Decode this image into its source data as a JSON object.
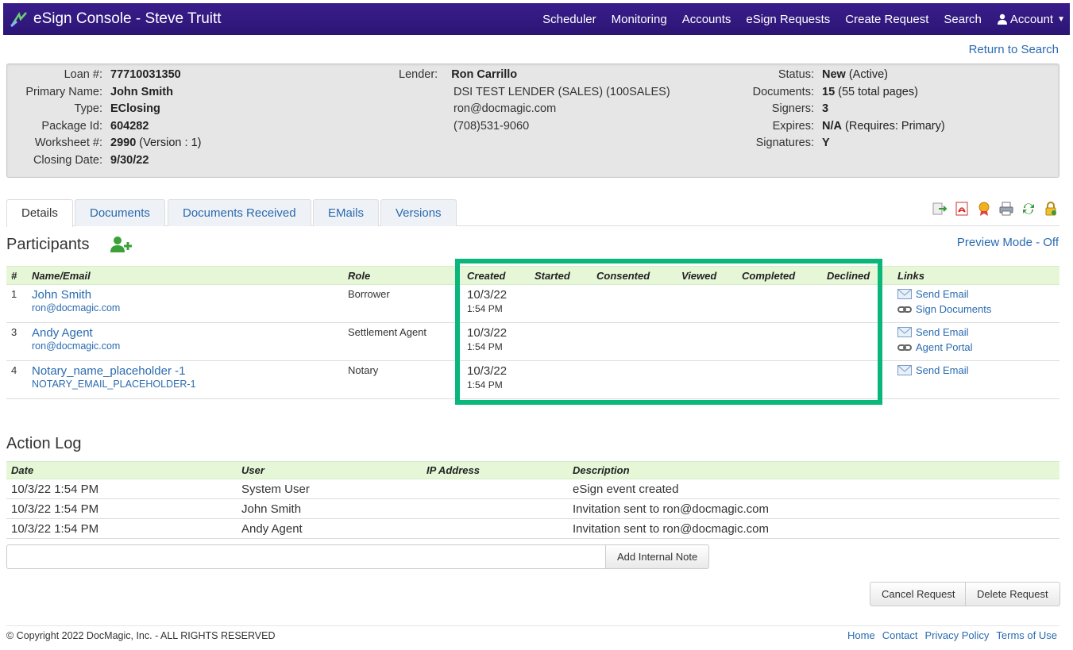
{
  "navbar": {
    "brand": "eSign Console - Steve Truitt",
    "links": [
      "Scheduler",
      "Monitoring",
      "Accounts",
      "eSign Requests",
      "Create Request",
      "Search"
    ],
    "account": "Account"
  },
  "return_link": "Return to Search",
  "info": {
    "col1": [
      {
        "label": "Loan #:",
        "value": "77710031350"
      },
      {
        "label": "Primary Name:",
        "value": "John Smith"
      },
      {
        "label": "Type:",
        "value": "EClosing"
      },
      {
        "label": "Package Id:",
        "value": "604282"
      },
      {
        "label": "Worksheet #:",
        "value": "2990",
        "extra": " (Version : 1)"
      },
      {
        "label": "Closing Date:",
        "value": "9/30/22"
      }
    ],
    "lender": {
      "label": "Lender:",
      "name": "Ron Carrillo",
      "company": "DSI TEST LENDER (SALES) (100SALES)",
      "email": "ron@docmagic.com",
      "phone": "(708)531-9060"
    },
    "col3": [
      {
        "label": "Status:",
        "value": "New",
        "extra": " (Active)"
      },
      {
        "label": "Documents:",
        "value": "15",
        "extra": " (55 total pages)"
      },
      {
        "label": "Signers:",
        "value": "3",
        "extra": ""
      },
      {
        "label": "Expires:",
        "value": "N/A",
        "extra": " (Requires: Primary)"
      },
      {
        "label": "Signatures:",
        "value": "Y",
        "extra": ""
      }
    ]
  },
  "tabs": [
    "Details",
    "Documents",
    "Documents Received",
    "EMails",
    "Versions"
  ],
  "toolbar_icons": [
    "export-icon",
    "pdf-icon",
    "certificate-icon",
    "print-icon",
    "refresh-icon",
    "lock-icon"
  ],
  "participants": {
    "title": "Participants",
    "preview_mode": "Preview Mode - Off",
    "columns": [
      "#",
      "Name/Email",
      "Role",
      "Created",
      "Started",
      "Consented",
      "Viewed",
      "Completed",
      "Declined",
      "Links"
    ],
    "rows": [
      {
        "num": "1",
        "name": "John Smith",
        "email": "ron@docmagic.com",
        "role": "Borrower",
        "created_date": "10/3/22",
        "created_time": "1:54 PM",
        "links": [
          {
            "icon": "email-icon",
            "label": "Send Email"
          },
          {
            "icon": "chain-link-icon",
            "label": "Sign Documents"
          }
        ]
      },
      {
        "num": "3",
        "name": "Andy Agent",
        "email": "ron@docmagic.com",
        "role": "Settlement Agent",
        "created_date": "10/3/22",
        "created_time": "1:54 PM",
        "links": [
          {
            "icon": "email-icon",
            "label": "Send Email"
          },
          {
            "icon": "chain-link-icon",
            "label": "Agent Portal"
          }
        ]
      },
      {
        "num": "4",
        "name": "Notary_name_placeholder -1",
        "email": "NOTARY_EMAIL_PLACEHOLDER-1",
        "role": "Notary",
        "created_date": "10/3/22",
        "created_time": "1:54 PM",
        "links": [
          {
            "icon": "email-icon",
            "label": "Send Email"
          }
        ]
      }
    ]
  },
  "action_log": {
    "title": "Action Log",
    "columns": [
      "Date",
      "User",
      "IP Address",
      "Description"
    ],
    "rows": [
      {
        "date": "10/3/22 1:54 PM",
        "user": "System User",
        "ip": "",
        "description": "eSign event created"
      },
      {
        "date": "10/3/22 1:54 PM",
        "user": "John Smith",
        "ip": "",
        "description": "Invitation sent to ron@docmagic.com"
      },
      {
        "date": "10/3/22 1:54 PM",
        "user": "Andy Agent",
        "ip": "",
        "description": "Invitation sent to ron@docmagic.com"
      }
    ],
    "note_value": "",
    "add_note_label": "Add Internal Note"
  },
  "actions": {
    "cancel": "Cancel Request",
    "delete": "Delete Request"
  },
  "footer": {
    "copyright": "© Copyright 2022 DocMagic, Inc. - ALL RIGHTS RESERVED",
    "links": [
      "Home",
      "Contact",
      "Privacy Policy",
      "Terms of Use"
    ]
  },
  "colors": {
    "navbar": "#2b1574",
    "highlight": "#0ab77a",
    "table_header": "#e6f7d8",
    "link": "#2a6bb0"
  }
}
